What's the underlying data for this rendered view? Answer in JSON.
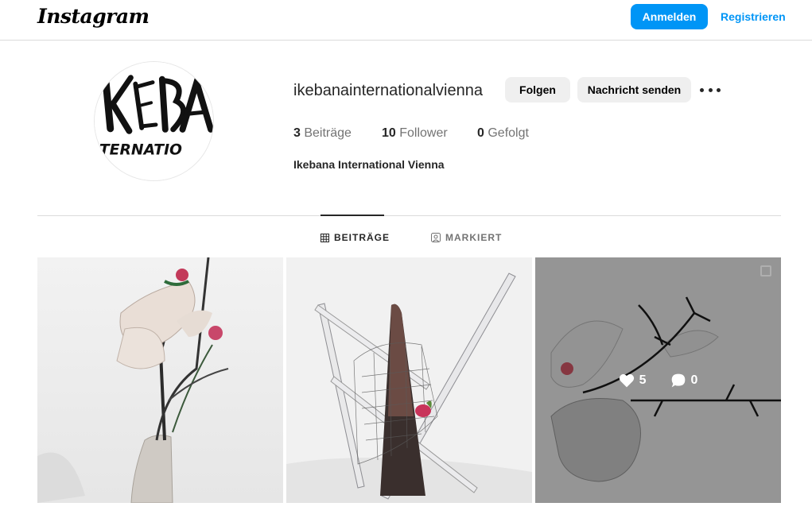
{
  "header": {
    "logo_text": "Instagram",
    "login_label": "Anmelden",
    "register_label": "Registrieren"
  },
  "profile": {
    "username": "ikebanainternationalvienna",
    "follow_label": "Folgen",
    "message_label": "Nachricht senden",
    "more_icon": "more-horizontal-icon",
    "avatar_text_top": "KEBA",
    "avatar_text_bottom": "TERNATIO",
    "stats": {
      "posts_count": "3",
      "posts_label": "Beiträge",
      "followers_count": "10",
      "followers_label": "Follower",
      "following_count": "0",
      "following_label": "Gefolgt"
    },
    "full_name": "Ikebana International Vienna"
  },
  "tabs": {
    "posts_label": "BEITRÄGE",
    "tagged_label": "MARKIERT",
    "posts_icon": "grid-icon",
    "tagged_icon": "tagged-user-icon"
  },
  "posts": [
    {
      "description_icon": "photo",
      "likes": "",
      "comments": ""
    },
    {
      "description_icon": "photo",
      "likes": "",
      "comments": ""
    },
    {
      "description_icon": "photo",
      "likes": "5",
      "comments": "0"
    }
  ],
  "colors": {
    "accent": "#0095f6",
    "button_gray": "#efefef",
    "text": "#262626",
    "muted": "#737373",
    "border": "#dbdbdb"
  }
}
